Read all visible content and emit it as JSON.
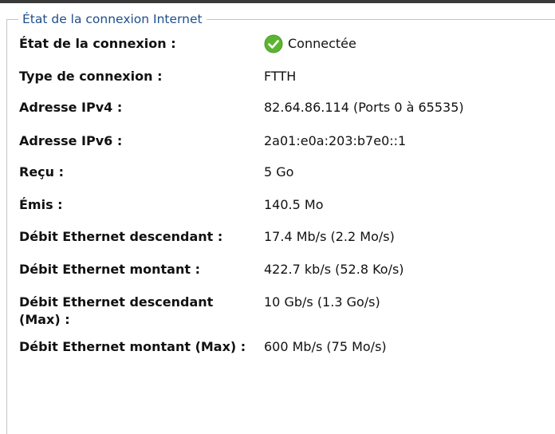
{
  "panel": {
    "legend": "État de la connexion Internet"
  },
  "status": {
    "label": "État de la connexion :",
    "value": "Connectée",
    "icon": "check-circle-icon",
    "color": "#5cb531"
  },
  "rows": [
    {
      "label": "Type de connexion :",
      "value": "FTTH"
    },
    {
      "label": "Adresse IPv4 :",
      "value": "82.64.86.114 (Ports 0 à 65535)"
    },
    {
      "label": "Adresse IPv6 :",
      "value": "2a01:e0a:203:b7e0::1"
    },
    {
      "label": "Reçu :",
      "value": "5 Go"
    },
    {
      "label": "Émis :",
      "value": "140.5 Mo"
    },
    {
      "label": "Débit Ethernet descendant :",
      "value": "17.4 Mb/s (2.2 Mo/s)"
    },
    {
      "label": "Débit Ethernet montant :",
      "value": "422.7 kb/s (52.8 Ko/s)"
    },
    {
      "label": "Débit Ethernet descendant (Max) :",
      "value": "10 Gb/s (1.3 Go/s)"
    },
    {
      "label": "Débit Ethernet montant (Max) :",
      "value": "600 Mb/s (75 Mo/s)"
    }
  ]
}
